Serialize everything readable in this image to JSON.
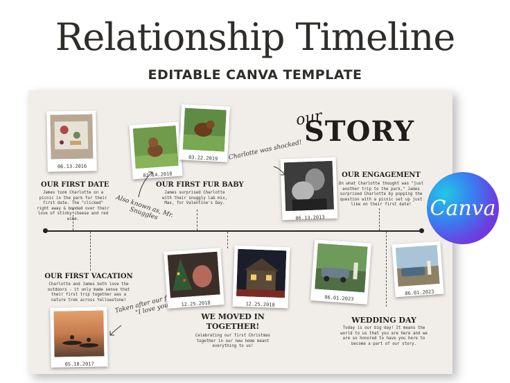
{
  "header": {
    "title": "Relationship Timeline",
    "subtitle": "EDITABLE CANVA TEMPLATE"
  },
  "story": {
    "our": "our",
    "main": "STORY"
  },
  "badge": {
    "text": "Canva"
  },
  "events": {
    "first_date": {
      "date": "06.13.2016",
      "heading": "OUR FIRST DATE",
      "body": "James took Charlotte on a picnic in the park for their first date. The \"clicked\" right away & bonded over their love of stinky cheese and red wine."
    },
    "fur_baby": {
      "date1": "02.14.2018",
      "date2": "03.22.2019",
      "heading": "OUR FIRST FUR BABY",
      "body": "James surprised Charlotte with their snuggly lab mix, Max, for Valentine's Day."
    },
    "engagement": {
      "date": "06.13.2013",
      "heading": "OUR ENGAGEMENT",
      "body": "On what Charlotte thought was \"just another trip to the park,\" James surprised Charlotte by popping the question with a picnic set up just like on their first date!"
    },
    "vacation": {
      "date": "05.10.2017",
      "heading": "OUR FIRST VACATION",
      "body": "Charlotte and James both love the outdoors - it only made sense that their first trip together was a nature trek across Yellowstone!"
    },
    "moved_in": {
      "date1": "12.25.2018",
      "date2": "12.25.2018",
      "heading_line1": "WE MOVED IN",
      "heading_line2": "TOGETHER!",
      "body": "Celebrating our first Christmas together in our new home meant everything to us!"
    },
    "wedding": {
      "date1": "06.01.2023",
      "date2": "06.01.2023",
      "heading": "WEDDING DAY",
      "body": "Today is our big day! It means the world to us that you are here and we are so honored to have you here to become a part of our story."
    }
  },
  "notes": {
    "shocked": "Charlotte was shocked!",
    "aka_line1": "Also known as, Mr.",
    "aka_line2": "Snuggles",
    "love_line1": "Taken after our first",
    "love_line2": "\"I love you\""
  }
}
